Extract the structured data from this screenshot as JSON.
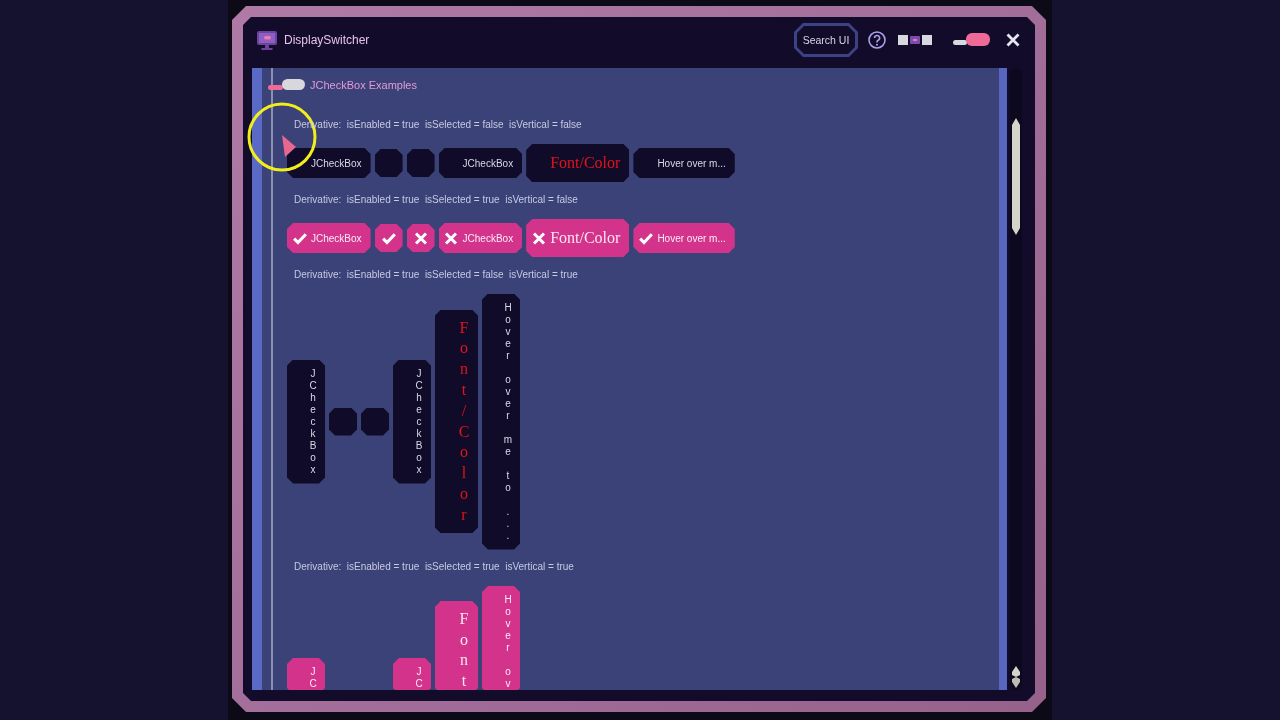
{
  "window": {
    "title": "DisplaySwitcher"
  },
  "title_bar": {
    "search_button": "Search UI",
    "toggle": {
      "on": true
    }
  },
  "panel": {
    "title": "JCheckBox Examples",
    "sections": [
      {
        "label": "Derivative:  isEnabled = true  isSelected = false  isVertical = false",
        "vertical": false,
        "items": [
          {
            "label": "JCheckBox",
            "selected": false,
            "custom_font": false
          },
          {
            "selected": false
          },
          {
            "selected": false
          },
          {
            "label": "JCheckBox",
            "selected": false,
            "custom_font": false
          },
          {
            "label": "Font/Color",
            "selected": false,
            "custom_font": true
          },
          {
            "label": "Hover over m...",
            "selected": false,
            "custom_font": false
          }
        ]
      },
      {
        "label": "Derivative:  isEnabled = true  isSelected = true  isVertical = false",
        "vertical": false,
        "items": [
          {
            "label": "JCheckBox",
            "selected": true,
            "custom_font": false,
            "kind": "check"
          },
          {
            "selected": true,
            "kind": "check"
          },
          {
            "selected": true,
            "kind": "cross"
          },
          {
            "label": "JCheckBox",
            "selected": true,
            "custom_font": false,
            "kind": "cross"
          },
          {
            "label": "Font/Color",
            "selected": true,
            "custom_font": true,
            "kind": "cross"
          },
          {
            "label": "Hover over m...",
            "selected": true,
            "custom_font": false,
            "kind": "check"
          }
        ]
      },
      {
        "label": "Derivative:  isEnabled = true  isSelected = false  isVertical = true",
        "vertical": true,
        "items": [
          {
            "label": "JCheckBox",
            "selected": false,
            "custom_font": false
          },
          {
            "selected": false
          },
          {
            "selected": false
          },
          {
            "label": "JCheckBox",
            "selected": false,
            "custom_font": false
          },
          {
            "label": "Font/Color",
            "selected": false,
            "custom_font": true
          },
          {
            "label": "Hover over me to ...",
            "selected": false,
            "custom_font": false
          }
        ]
      },
      {
        "label": "Derivative:  isEnabled = true  isSelected = true  isVertical = true",
        "vertical": true,
        "items": [
          {
            "label": "JC",
            "selected": true,
            "custom_font": false
          },
          {
            "label": "JC",
            "selected": true,
            "custom_font": false
          },
          {
            "label": "Font",
            "selected": true,
            "custom_font": true
          },
          {
            "label": "Hover ov",
            "selected": true,
            "custom_font": false
          }
        ]
      }
    ]
  }
}
